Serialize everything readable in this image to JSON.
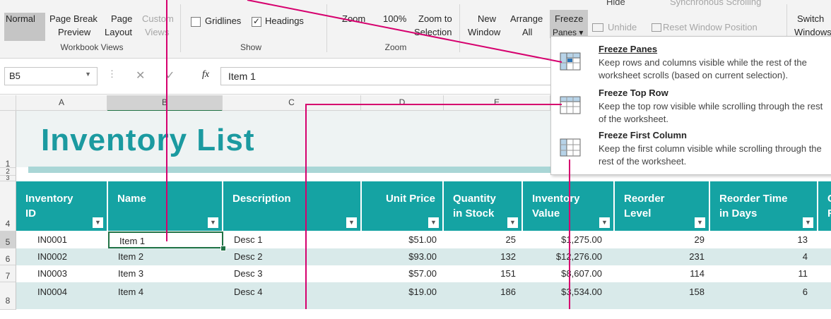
{
  "ribbon": {
    "workbook_views": {
      "normal": "Normal",
      "page_break_1": "Page Break",
      "page_break_2": "Preview",
      "page_layout_1": "Page",
      "page_layout_2": "Layout",
      "custom_views_1": "Custom",
      "custom_views_2": "Views",
      "group_label": "Workbook Views"
    },
    "show": {
      "gridlines": "Gridlines",
      "gridlines_checked": false,
      "headings": "Headings",
      "headings_checked": true,
      "group_label": "Show"
    },
    "zoom": {
      "zoom": "Zoom",
      "hundred": "100%",
      "zoom_to_1": "Zoom to",
      "zoom_to_2": "Selection",
      "group_label": "Zoom"
    },
    "window": {
      "new_1": "New",
      "new_2": "Window",
      "arrange_1": "Arrange",
      "arrange_2": "All",
      "freeze_1": "Freeze",
      "freeze_2": "Panes ▾",
      "hide": "Hide",
      "unhide": "Unhide",
      "sync_scroll": "Synchronous Scrolling",
      "reset_pos": "Reset Window Position",
      "switch_1": "Switch",
      "switch_2": "Windows"
    }
  },
  "formula_bar": {
    "name_box": "B5",
    "fx": "fx",
    "value": "Item 1"
  },
  "columns": [
    "A",
    "B",
    "C",
    "D",
    "E"
  ],
  "title": "Inventory List",
  "headers": {
    "inv_id_1": "Inventory",
    "inv_id_2": "ID",
    "name": "Name",
    "desc": "Description",
    "unit_price": "Unit Price",
    "qty_1": "Quantity",
    "qty_2": "in Stock",
    "inv_val_1": "Inventory",
    "inv_val_2": "Value",
    "reorder_1": "Reorder",
    "reorder_2": "Level",
    "rtime_1": "Reorder Time",
    "rtime_2": "in Days",
    "cut_1": "C",
    "cut_2": "F"
  },
  "row_numbers": {
    "r1": "1",
    "r2": "2",
    "r3": "3",
    "r4": "4",
    "r5": "5",
    "r6": "6",
    "r7": "7",
    "r8": "8"
  },
  "rows": [
    {
      "id": "IN0001",
      "name": "Item 1",
      "desc": "Desc 1",
      "price": "$51.00",
      "qty": "25",
      "value": "$1,275.00",
      "reorder": "29",
      "days": "13"
    },
    {
      "id": "IN0002",
      "name": "Item 2",
      "desc": "Desc 2",
      "price": "$93.00",
      "qty": "132",
      "value": "$12,276.00",
      "reorder": "231",
      "days": "4"
    },
    {
      "id": "IN0003",
      "name": "Item 3",
      "desc": "Desc 3",
      "price": "$57.00",
      "qty": "151",
      "value": "$8,607.00",
      "reorder": "114",
      "days": "11"
    },
    {
      "id": "IN0004",
      "name": "Item 4",
      "desc": "Desc 4",
      "price": "$19.00",
      "qty": "186",
      "value": "$3,534.00",
      "reorder": "158",
      "days": "6"
    }
  ],
  "freeze_menu": {
    "panes_title": "Freeze Panes",
    "panes_desc": "Keep rows and columns visible while the rest of the worksheet scrolls (based on current selection).",
    "toprow_title": "Freeze Top Row",
    "toprow_desc": "Keep the top row visible while scrolling through the rest of the worksheet.",
    "firstcol_title": "Freeze First Column",
    "firstcol_desc": "Keep the first column visible while scrolling through the rest of the worksheet."
  },
  "colors": {
    "header_teal": "#15a3a3",
    "title_teal": "#1b9aa0",
    "callout": "#d6006e"
  }
}
